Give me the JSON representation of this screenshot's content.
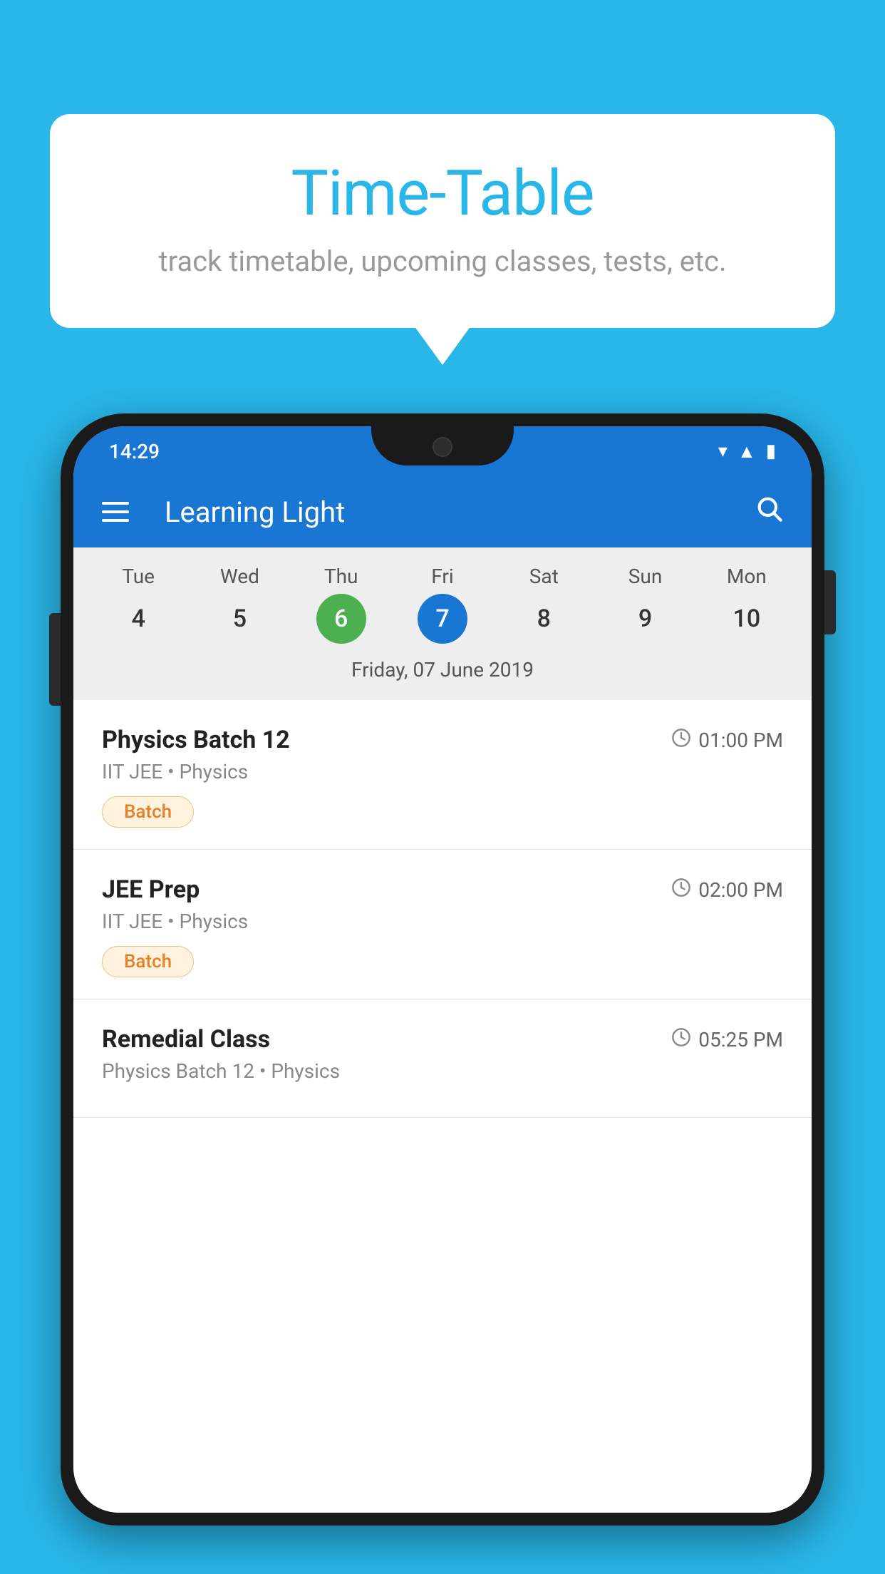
{
  "background_color": "#29B6E8",
  "speech_bubble": {
    "title": "Time-Table",
    "subtitle": "track timetable, upcoming classes, tests, etc."
  },
  "phone": {
    "status_bar": {
      "time": "14:29",
      "wifi_icon": "wifi",
      "signal_icon": "signal",
      "battery_icon": "battery"
    },
    "app_bar": {
      "title": "Learning Light",
      "menu_icon": "hamburger",
      "search_icon": "search"
    },
    "calendar": {
      "days": [
        {
          "name": "Tue",
          "num": "4",
          "state": "normal"
        },
        {
          "name": "Wed",
          "num": "5",
          "state": "normal"
        },
        {
          "name": "Thu",
          "num": "6",
          "state": "today"
        },
        {
          "name": "Fri",
          "num": "7",
          "state": "selected"
        },
        {
          "name": "Sat",
          "num": "8",
          "state": "normal"
        },
        {
          "name": "Sun",
          "num": "9",
          "state": "normal"
        },
        {
          "name": "Mon",
          "num": "10",
          "state": "normal"
        }
      ],
      "selected_date_label": "Friday, 07 June 2019"
    },
    "schedule": [
      {
        "title": "Physics Batch 12",
        "time": "01:00 PM",
        "subtitle": "IIT JEE • Physics",
        "badge": "Batch"
      },
      {
        "title": "JEE Prep",
        "time": "02:00 PM",
        "subtitle": "IIT JEE • Physics",
        "badge": "Batch"
      },
      {
        "title": "Remedial Class",
        "time": "05:25 PM",
        "subtitle": "Physics Batch 12 • Physics",
        "badge": null
      }
    ]
  }
}
